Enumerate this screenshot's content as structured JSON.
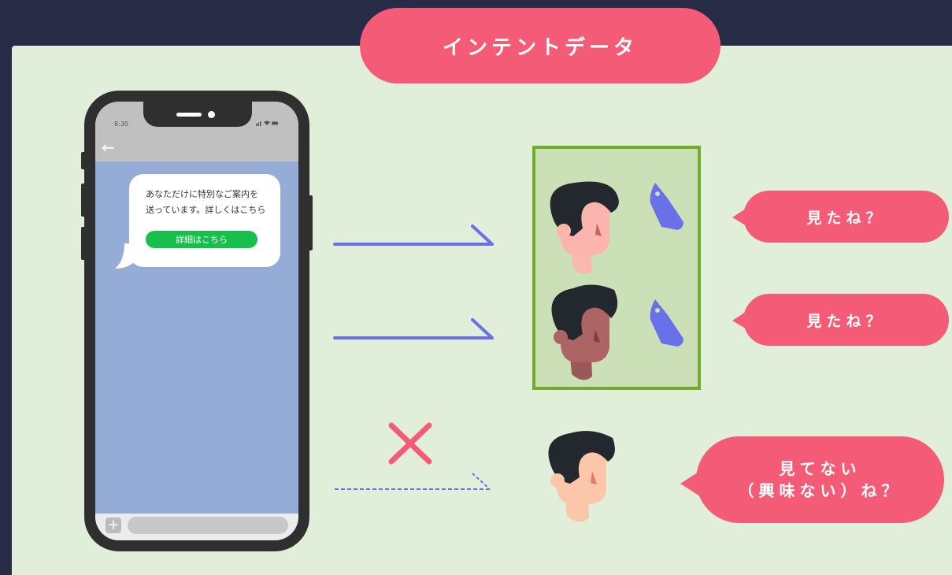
{
  "title": "インテントデータ",
  "phone": {
    "time": "8:30",
    "message_line1": "あなただけに特別なご案内を",
    "message_line2": "送っています。詳しくはこちら",
    "detail_button": "詳細はこちら"
  },
  "reactions": {
    "viewed_1": "見たね？",
    "viewed_2": "見たね？",
    "not_viewed_line1": "見てない",
    "not_viewed_line2": "（興味ない）ね？"
  },
  "colors": {
    "accent_pink": "#f45b77",
    "arrow_blue": "#6a70e8",
    "highlight_green": "#6fad2b",
    "tag_blue": "#6a70e8"
  },
  "icons": [
    "arrow-right-icon",
    "cross-icon",
    "tag-icon",
    "person-face-icon",
    "back-arrow-icon",
    "plus-icon"
  ]
}
